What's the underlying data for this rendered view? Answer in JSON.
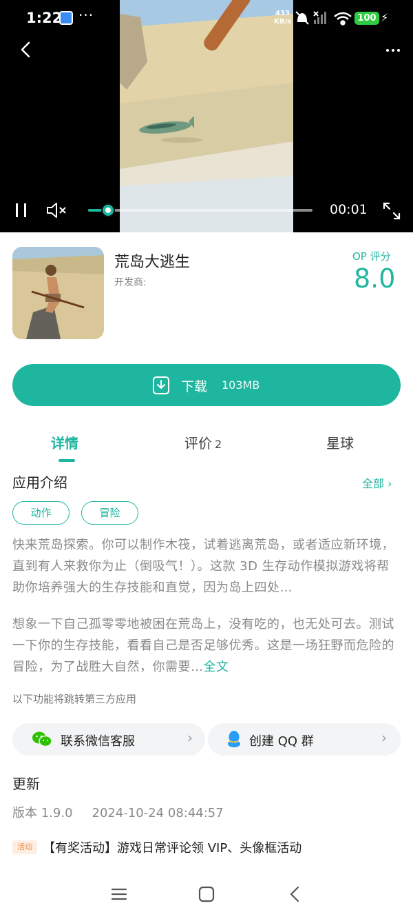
{
  "status_bar": {
    "time": "1:22",
    "dots": "···",
    "net_speed_value": "433",
    "net_speed_unit": "KB/s",
    "battery": "100"
  },
  "video": {
    "elapsed": "00:01",
    "progress_fraction": 0.09,
    "more": "⋮"
  },
  "app": {
    "name": "荒岛大逃生",
    "developer": "开发商:",
    "rating_label": "OP 评分",
    "rating_value": "8.0"
  },
  "download": {
    "label": "下载",
    "size": "103MB"
  },
  "tabs": [
    {
      "label": "详情",
      "count": ""
    },
    {
      "label": "评价",
      "count": "2"
    },
    {
      "label": "星球",
      "count": ""
    }
  ],
  "intro": {
    "title": "应用介绍",
    "see_all": "全部 ›",
    "tags": [
      "动作",
      "冒险"
    ],
    "paragraph_1": "快来荒岛探索。你可以制作木筏，试着逃离荒岛，或者适应新环境，直到有人来救你为止（倒吸气！）。这款 3D 生存动作模拟游戏将帮助你培养强大的生存技能和直觉，因为岛上四处…",
    "paragraph_2": "想象一下自己孤零零地被困在荒岛上，没有吃的，也无处可去。测试一下你的生存技能，看看自己是否足够优秀。这是一场狂野而危险的冒险，为了战胜大自然，你需要…",
    "full_text_link": "全文",
    "third_party_note": "以下功能将跳转第三方应用"
  },
  "services": {
    "wechat_label": "联系微信客服",
    "qq_label": "创建 QQ 群",
    "chevron": "›"
  },
  "update": {
    "title": "更新",
    "version": "版本 1.9.0",
    "date": "2024-10-24 08:44:57",
    "activity_badge": "活动",
    "activity_text": "【有奖活动】游戏日常评论领 VIP、头像框活动"
  },
  "colors": {
    "accent": "#1fb6a0",
    "battery": "#2ecc40",
    "activity_badge": "#f08a3c"
  }
}
